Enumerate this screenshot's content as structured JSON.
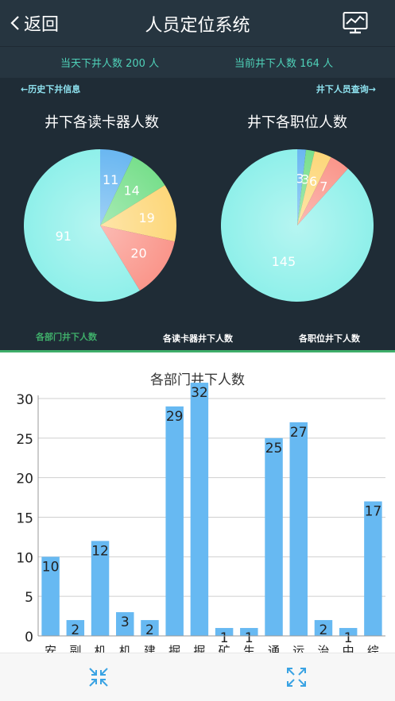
{
  "header": {
    "back_label": "返回",
    "title": "人员定位系统"
  },
  "stats": {
    "today_label": "当天下井人数 200 人",
    "current_label": "当前井下人数 164 人"
  },
  "links": {
    "history": "←历史下井信息",
    "query": "井下人员查询→"
  },
  "charts_titles": {
    "reader": "井下各读卡器人数",
    "position": "井下各职位人数",
    "department": "各部门井下人数"
  },
  "tabs": [
    {
      "label": "各部门井下人数",
      "active": true
    },
    {
      "label": "各读卡器井下人数",
      "active": false
    },
    {
      "label": "各职位井下人数",
      "active": false
    }
  ],
  "colors": {
    "accent_green": "#3fae6a",
    "header_bg": "#263540",
    "bar": "#67b9f2"
  },
  "chart_data": [
    {
      "type": "pie",
      "title": "井下各读卡器人数",
      "slices": [
        {
          "value": 11,
          "color": "#6ab7f1"
        },
        {
          "value": 14,
          "color": "#78df8c"
        },
        {
          "value": 19,
          "color": "#fdd77a"
        },
        {
          "value": 20,
          "color": "#fa968b"
        },
        {
          "value": 91,
          "color": "#8ff0ea"
        }
      ]
    },
    {
      "type": "pie",
      "title": "井下各职位人数",
      "slices": [
        {
          "value": 3,
          "color": "#6ab7f1"
        },
        {
          "value": 3,
          "color": "#78df8c"
        },
        {
          "value": 6,
          "color": "#fdd77a"
        },
        {
          "value": 7,
          "color": "#fa968b"
        },
        {
          "value": 145,
          "color": "#8ff0ea"
        }
      ]
    },
    {
      "type": "bar",
      "title": "各部门井下人数",
      "categories": [
        "安",
        "副",
        "机",
        "机",
        "建",
        "掘",
        "掘",
        "矿",
        "生",
        "通",
        "运",
        "治",
        "中",
        "综"
      ],
      "values": [
        10,
        2,
        12,
        3,
        2,
        29,
        32,
        1,
        1,
        25,
        27,
        2,
        1,
        17
      ],
      "ylim": [
        0,
        30
      ],
      "yticks": [
        0,
        5,
        10,
        15,
        20,
        25,
        30
      ],
      "grid": true
    }
  ]
}
